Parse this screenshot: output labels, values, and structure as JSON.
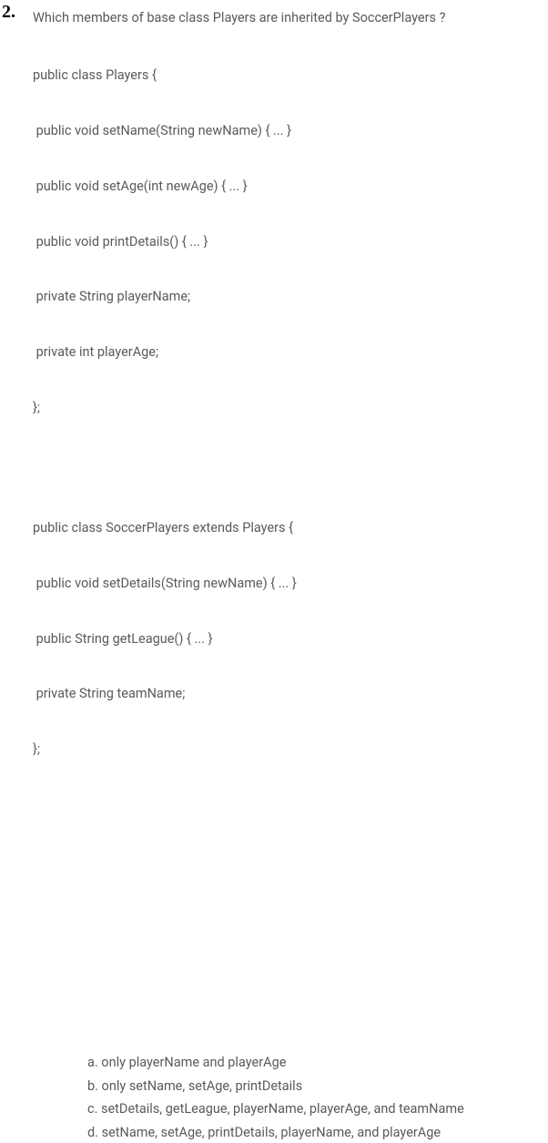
{
  "questionNumber": "2.",
  "question": "Which members of base class Players are inherited by SoccerPlayers ?",
  "code1": {
    "l1": "public class Players {",
    "l2": " public void setName(String newName) { ... }",
    "l3": " public void setAge(int newAge) { ... }",
    "l4": " public void printDetails() { ... }",
    "l5": " private String playerName;",
    "l6": " private int playerAge;",
    "l7": "};"
  },
  "code2": {
    "l1": "public class SoccerPlayers extends Players {",
    "l2": " public void setDetails(String newName) { ... }",
    "l3": " public String getLeague() { ... }",
    "l4": " private String teamName;",
    "l5": "};"
  },
  "options": {
    "a": "a. only playerName and playerAge",
    "b": "b. only setName, setAge, printDetails",
    "c": "c. setDetails, getLeague, playerName, playerAge, and teamName",
    "d": "d. setName, setAge, printDetails, playerName, and playerAge"
  }
}
